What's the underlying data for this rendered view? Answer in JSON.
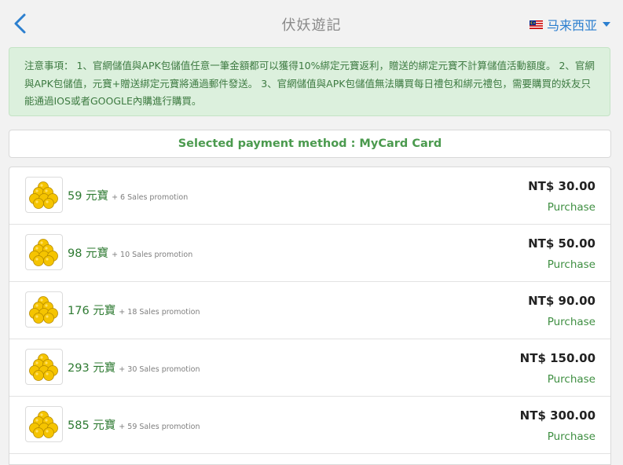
{
  "header": {
    "title": "伏妖遊記",
    "region_label": "马来西亚"
  },
  "notice": {
    "text": "注意事項： 1、官網儲值與APK包儲值任意一筆金額都可以獲得10%綁定元寶返利，贈送的綁定元寶不計算儲值活動額度。 2、官網與APK包儲值，元寶+贈送綁定元寶將通過郵件發送。 3、官網儲值與APK包儲值無法購買每日禮包和綁元禮包，需要購買的妖友只能通過IOS或者GOOGLE內購進行購買。"
  },
  "payment_method": {
    "label": "Selected payment method : MyCard Card"
  },
  "packages": [
    {
      "amount": "59 元寶",
      "bonus": "+ 6 Sales promotion",
      "price": "NT$ 30.00",
      "action": "Purchase"
    },
    {
      "amount": "98 元寶",
      "bonus": "+ 10 Sales promotion",
      "price": "NT$ 50.00",
      "action": "Purchase"
    },
    {
      "amount": "176 元寶",
      "bonus": "+ 18 Sales promotion",
      "price": "NT$ 90.00",
      "action": "Purchase"
    },
    {
      "amount": "293 元寶",
      "bonus": "+ 30 Sales promotion",
      "price": "NT$ 150.00",
      "action": "Purchase"
    },
    {
      "amount": "585 元寶",
      "bonus": "+ 59 Sales promotion",
      "price": "NT$ 300.00",
      "action": "Purchase"
    }
  ],
  "colors": {
    "accent_blue": "#2c7fcf",
    "notice_bg": "#dcf0dd",
    "green_text": "#2e7a32",
    "coin_gold": "#f5c400"
  },
  "icons": {
    "back": "chevron-left-icon",
    "flag": "malaysia-flag-icon",
    "dropdown": "caret-down-icon",
    "package": "gold-coins-icon"
  }
}
